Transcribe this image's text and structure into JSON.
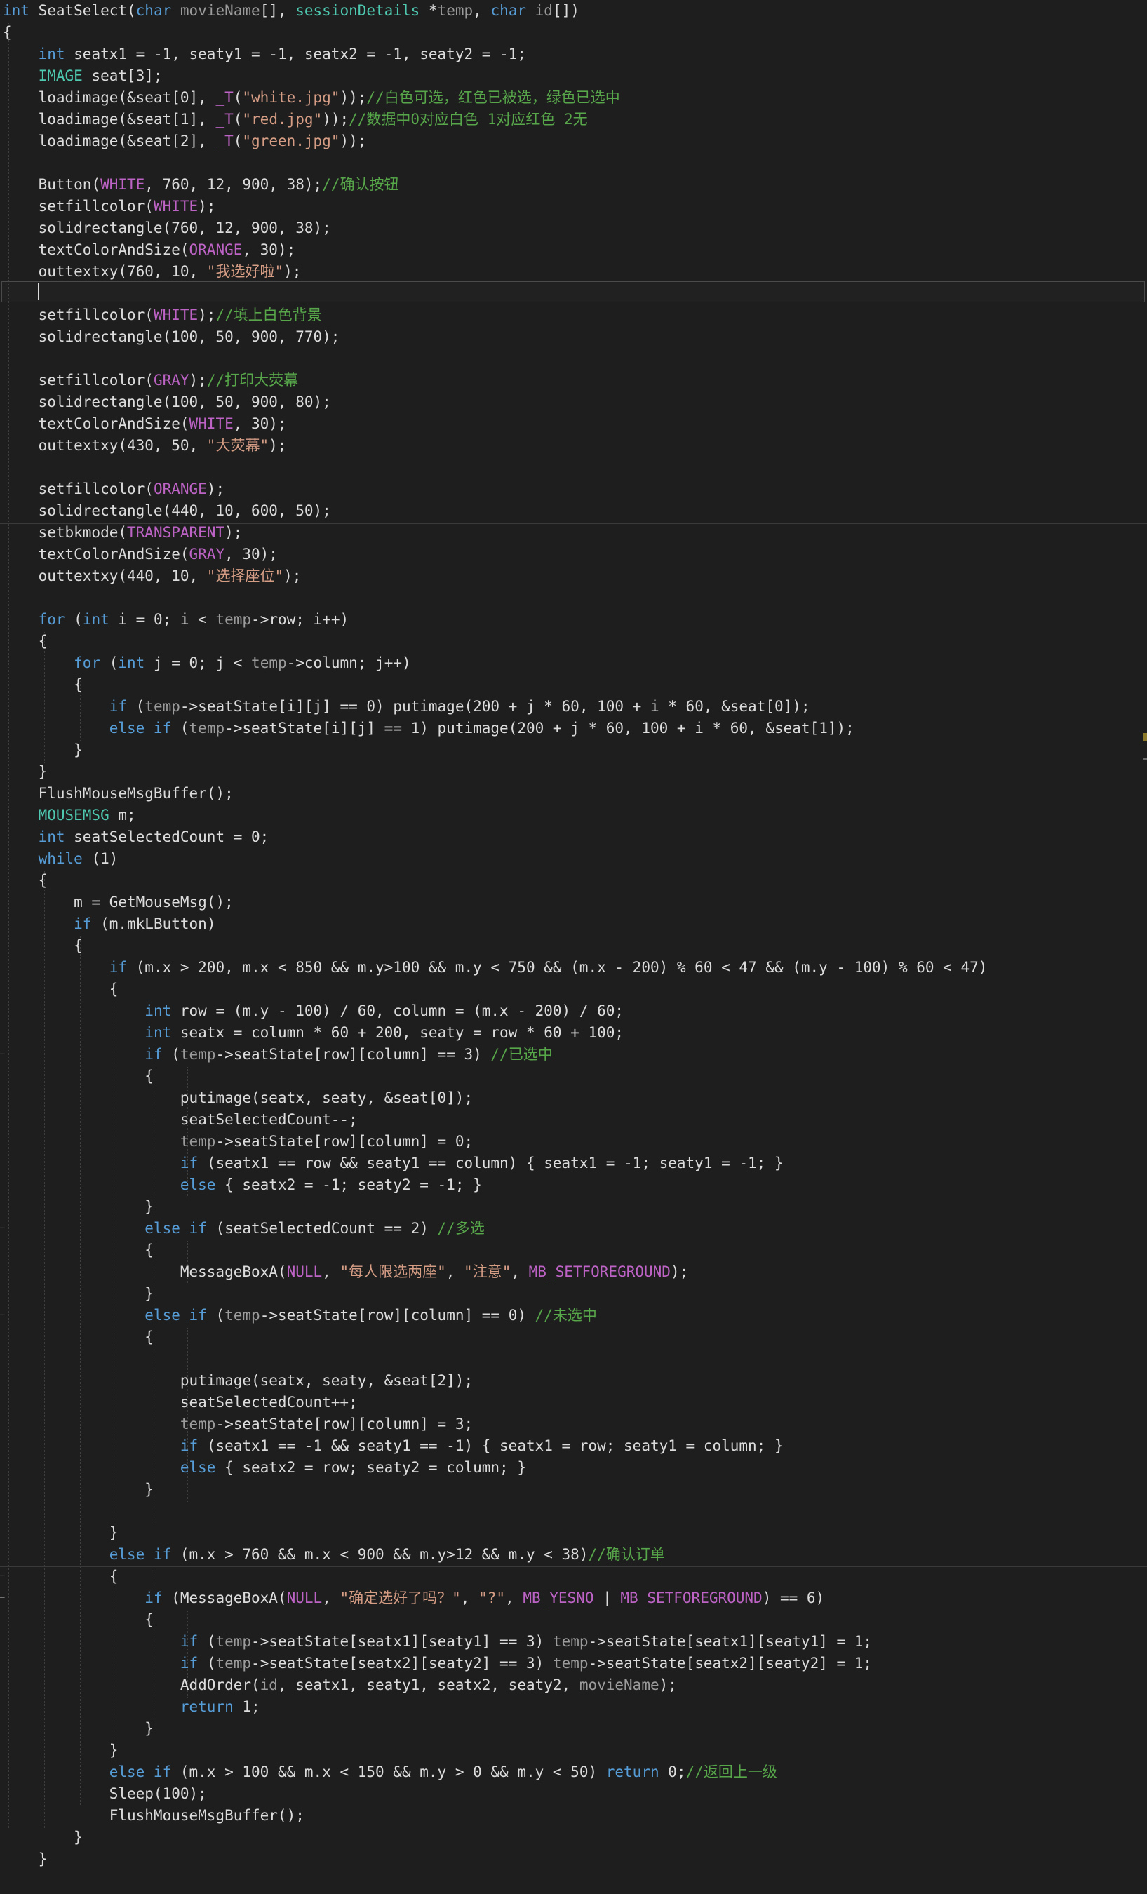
{
  "colors": {
    "background": "#1e1e1e",
    "keyword": "#569cd6",
    "type": "#4ec9b0",
    "string": "#d69d85",
    "comment": "#57a64a",
    "macro": "#bd63c5",
    "param": "#9b9b9b",
    "plain": "#dcdcdc"
  },
  "code": {
    "lines": [
      [
        [
          "kw",
          "int"
        ],
        [
          "pl",
          " SeatSelect("
        ],
        [
          "kw",
          "char"
        ],
        [
          "var",
          " movieName"
        ],
        [
          "pl",
          "[], "
        ],
        [
          "ty",
          "sessionDetails"
        ],
        [
          "pl",
          " *"
        ],
        [
          "var",
          "temp"
        ],
        [
          "pl",
          ", "
        ],
        [
          "kw",
          "char"
        ],
        [
          "var",
          " id"
        ],
        [
          "pl",
          "[])"
        ]
      ],
      [
        [
          "pl",
          "{"
        ]
      ],
      [
        [
          "pl",
          "    "
        ],
        [
          "kw",
          "int"
        ],
        [
          "pl",
          " seatx1 = -1, seaty1 = -1, seatx2 = -1, seaty2 = -1;"
        ]
      ],
      [
        [
          "pl",
          "    "
        ],
        [
          "ty",
          "IMAGE"
        ],
        [
          "pl",
          " seat[3];"
        ]
      ],
      [
        [
          "pl",
          "    loadimage(&seat[0], "
        ],
        [
          "mac",
          "_T"
        ],
        [
          "pl",
          "("
        ],
        [
          "str",
          "\"white.jpg\""
        ],
        [
          "pl",
          "));"
        ],
        [
          "cm",
          "//白色可选，红色已被选，绿色已选中"
        ]
      ],
      [
        [
          "pl",
          "    loadimage(&seat[1], "
        ],
        [
          "mac",
          "_T"
        ],
        [
          "pl",
          "("
        ],
        [
          "str",
          "\"red.jpg\""
        ],
        [
          "pl",
          "));"
        ],
        [
          "cm",
          "//数据中0对应白色 1对应红色 2无"
        ]
      ],
      [
        [
          "pl",
          "    loadimage(&seat[2], "
        ],
        [
          "mac",
          "_T"
        ],
        [
          "pl",
          "("
        ],
        [
          "str",
          "\"green.jpg\""
        ],
        [
          "pl",
          "));"
        ]
      ],
      [
        [
          "pl",
          ""
        ]
      ],
      [
        [
          "pl",
          "    Button("
        ],
        [
          "mac",
          "WHITE"
        ],
        [
          "pl",
          ", 760, 12, 900, 38);"
        ],
        [
          "cm",
          "//确认按钮"
        ]
      ],
      [
        [
          "pl",
          "    setfillcolor("
        ],
        [
          "mac",
          "WHITE"
        ],
        [
          "pl",
          ");"
        ]
      ],
      [
        [
          "pl",
          "    solidrectangle(760, 12, 900, 38);"
        ]
      ],
      [
        [
          "pl",
          "    textColorAndSize("
        ],
        [
          "mac",
          "ORANGE"
        ],
        [
          "pl",
          ", 30);"
        ]
      ],
      [
        [
          "pl",
          "    outtextxy(760, 10, "
        ],
        [
          "str",
          "\"我选好啦\""
        ],
        [
          "pl",
          ");"
        ]
      ],
      [
        [
          "pl",
          ""
        ]
      ],
      [
        [
          "pl",
          "    setfillcolor("
        ],
        [
          "mac",
          "WHITE"
        ],
        [
          "pl",
          ");"
        ],
        [
          "cm",
          "//填上白色背景"
        ]
      ],
      [
        [
          "pl",
          "    solidrectangle(100, 50, 900, 770);"
        ]
      ],
      [
        [
          "pl",
          ""
        ]
      ],
      [
        [
          "pl",
          "    setfillcolor("
        ],
        [
          "mac",
          "GRAY"
        ],
        [
          "pl",
          ");"
        ],
        [
          "cm",
          "//打印大荧幕"
        ]
      ],
      [
        [
          "pl",
          "    solidrectangle(100, 50, 900, 80);"
        ]
      ],
      [
        [
          "pl",
          "    textColorAndSize("
        ],
        [
          "mac",
          "WHITE"
        ],
        [
          "pl",
          ", 30);"
        ]
      ],
      [
        [
          "pl",
          "    outtextxy(430, 50, "
        ],
        [
          "str",
          "\"大荧幕\""
        ],
        [
          "pl",
          ");"
        ]
      ],
      [
        [
          "pl",
          ""
        ]
      ],
      [
        [
          "pl",
          "    setfillcolor("
        ],
        [
          "mac",
          "ORANGE"
        ],
        [
          "pl",
          ");"
        ]
      ],
      [
        [
          "pl",
          "    solidrectangle(440, 10, 600, 50);"
        ]
      ],
      [
        [
          "pl",
          "    setbkmode("
        ],
        [
          "mac",
          "TRANSPARENT"
        ],
        [
          "pl",
          ");"
        ]
      ],
      [
        [
          "pl",
          "    textColorAndSize("
        ],
        [
          "mac",
          "GRAY"
        ],
        [
          "pl",
          ", 30);"
        ]
      ],
      [
        [
          "pl",
          "    outtextxy(440, 10, "
        ],
        [
          "str",
          "\"选择座位\""
        ],
        [
          "pl",
          ");"
        ]
      ],
      [
        [
          "pl",
          ""
        ]
      ],
      [
        [
          "pl",
          "    "
        ],
        [
          "kw",
          "for"
        ],
        [
          "pl",
          " ("
        ],
        [
          "kw",
          "int"
        ],
        [
          "pl",
          " i = 0; i < "
        ],
        [
          "var",
          "temp"
        ],
        [
          "pl",
          "->row; i++)"
        ]
      ],
      [
        [
          "pl",
          "    {"
        ]
      ],
      [
        [
          "pl",
          "        "
        ],
        [
          "kw",
          "for"
        ],
        [
          "pl",
          " ("
        ],
        [
          "kw",
          "int"
        ],
        [
          "pl",
          " j = 0; j < "
        ],
        [
          "var",
          "temp"
        ],
        [
          "pl",
          "->column; j++)"
        ]
      ],
      [
        [
          "pl",
          "        {"
        ]
      ],
      [
        [
          "pl",
          "            "
        ],
        [
          "kw",
          "if"
        ],
        [
          "pl",
          " ("
        ],
        [
          "var",
          "temp"
        ],
        [
          "pl",
          "->seatState[i][j] == 0) putimage(200 + j * 60, 100 + i * 60, &seat[0]);"
        ]
      ],
      [
        [
          "pl",
          "            "
        ],
        [
          "kw",
          "else if"
        ],
        [
          "pl",
          " ("
        ],
        [
          "var",
          "temp"
        ],
        [
          "pl",
          "->seatState[i][j] == 1) putimage(200 + j * 60, 100 + i * 60, &seat[1]);"
        ]
      ],
      [
        [
          "pl",
          "        }"
        ]
      ],
      [
        [
          "pl",
          "    }"
        ]
      ],
      [
        [
          "pl",
          "    FlushMouseMsgBuffer();"
        ]
      ],
      [
        [
          "pl",
          "    "
        ],
        [
          "ty",
          "MOUSEMSG"
        ],
        [
          "pl",
          " m;"
        ]
      ],
      [
        [
          "pl",
          "    "
        ],
        [
          "kw",
          "int"
        ],
        [
          "pl",
          " seatSelectedCount = 0;"
        ]
      ],
      [
        [
          "pl",
          "    "
        ],
        [
          "kw",
          "while"
        ],
        [
          "pl",
          " (1)"
        ]
      ],
      [
        [
          "pl",
          "    {"
        ]
      ],
      [
        [
          "pl",
          "        m = GetMouseMsg();"
        ]
      ],
      [
        [
          "pl",
          "        "
        ],
        [
          "kw",
          "if"
        ],
        [
          "pl",
          " (m.mkLButton)"
        ]
      ],
      [
        [
          "pl",
          "        {"
        ]
      ],
      [
        [
          "pl",
          "            "
        ],
        [
          "kw",
          "if"
        ],
        [
          "pl",
          " (m.x > 200, m.x < 850 && m.y>100 && m.y < 750 && (m.x - 200) % 60 < 47 && (m.y - 100) % 60 < 47)"
        ]
      ],
      [
        [
          "pl",
          "            {"
        ]
      ],
      [
        [
          "pl",
          "                "
        ],
        [
          "kw",
          "int"
        ],
        [
          "pl",
          " row = (m.y - 100) / 60, column = (m.x - 200) / 60;"
        ]
      ],
      [
        [
          "pl",
          "                "
        ],
        [
          "kw",
          "int"
        ],
        [
          "pl",
          " seatx = column * 60 + 200, seaty = row * 60 + 100;"
        ]
      ],
      [
        [
          "pl",
          "                "
        ],
        [
          "kw",
          "if"
        ],
        [
          "pl",
          " ("
        ],
        [
          "var",
          "temp"
        ],
        [
          "pl",
          "->seatState[row][column] == 3) "
        ],
        [
          "cm",
          "//已选中"
        ]
      ],
      [
        [
          "pl",
          "                {"
        ]
      ],
      [
        [
          "pl",
          "                    putimage(seatx, seaty, &seat[0]);"
        ]
      ],
      [
        [
          "pl",
          "                    seatSelectedCount--;"
        ]
      ],
      [
        [
          "pl",
          "                    "
        ],
        [
          "var",
          "temp"
        ],
        [
          "pl",
          "->seatState[row][column] = 0;"
        ]
      ],
      [
        [
          "pl",
          "                    "
        ],
        [
          "kw",
          "if"
        ],
        [
          "pl",
          " (seatx1 == row && seaty1 == column) { seatx1 = -1; seaty1 = -1; }"
        ]
      ],
      [
        [
          "pl",
          "                    "
        ],
        [
          "kw",
          "else"
        ],
        [
          "pl",
          " { seatx2 = -1; seaty2 = -1; }"
        ]
      ],
      [
        [
          "pl",
          "                }"
        ]
      ],
      [
        [
          "pl",
          "                "
        ],
        [
          "kw",
          "else if"
        ],
        [
          "pl",
          " (seatSelectedCount == 2) "
        ],
        [
          "cm",
          "//多选"
        ]
      ],
      [
        [
          "pl",
          "                {"
        ]
      ],
      [
        [
          "pl",
          "                    MessageBoxA("
        ],
        [
          "mac",
          "NULL"
        ],
        [
          "pl",
          ", "
        ],
        [
          "str",
          "\"每人限选两座\""
        ],
        [
          "pl",
          ", "
        ],
        [
          "str",
          "\"注意\""
        ],
        [
          "pl",
          ", "
        ],
        [
          "mac",
          "MB_SETFOREGROUND"
        ],
        [
          "pl",
          ");"
        ]
      ],
      [
        [
          "pl",
          "                }"
        ]
      ],
      [
        [
          "pl",
          "                "
        ],
        [
          "kw",
          "else if"
        ],
        [
          "pl",
          " ("
        ],
        [
          "var",
          "temp"
        ],
        [
          "pl",
          "->seatState[row][column] == 0) "
        ],
        [
          "cm",
          "//未选中"
        ]
      ],
      [
        [
          "pl",
          "                {"
        ]
      ],
      [
        [
          "pl",
          ""
        ]
      ],
      [
        [
          "pl",
          "                    putimage(seatx, seaty, &seat[2]);"
        ]
      ],
      [
        [
          "pl",
          "                    seatSelectedCount++;"
        ]
      ],
      [
        [
          "pl",
          "                    "
        ],
        [
          "var",
          "temp"
        ],
        [
          "pl",
          "->seatState[row][column] = 3;"
        ]
      ],
      [
        [
          "pl",
          "                    "
        ],
        [
          "kw",
          "if"
        ],
        [
          "pl",
          " (seatx1 == -1 && seaty1 == -1) { seatx1 = row; seaty1 = column; }"
        ]
      ],
      [
        [
          "pl",
          "                    "
        ],
        [
          "kw",
          "else"
        ],
        [
          "pl",
          " { seatx2 = row; seaty2 = column; }"
        ]
      ],
      [
        [
          "pl",
          "                }"
        ]
      ],
      [
        [
          "pl",
          ""
        ]
      ],
      [
        [
          "pl",
          "            }"
        ]
      ],
      [
        [
          "pl",
          "            "
        ],
        [
          "kw",
          "else if"
        ],
        [
          "pl",
          " (m.x > 760 && m.x < 900 && m.y>12 && m.y < 38)"
        ],
        [
          "cm",
          "//确认订单"
        ]
      ],
      [
        [
          "pl",
          "            {"
        ]
      ],
      [
        [
          "pl",
          "                "
        ],
        [
          "kw",
          "if"
        ],
        [
          "pl",
          " (MessageBoxA("
        ],
        [
          "mac",
          "NULL"
        ],
        [
          "pl",
          ", "
        ],
        [
          "str",
          "\"确定选好了吗？\""
        ],
        [
          "pl",
          ", "
        ],
        [
          "str",
          "\"?\""
        ],
        [
          "pl",
          ", "
        ],
        [
          "mac",
          "MB_YESNO"
        ],
        [
          "pl",
          " | "
        ],
        [
          "mac",
          "MB_SETFOREGROUND"
        ],
        [
          "pl",
          ") == 6)"
        ]
      ],
      [
        [
          "pl",
          "                {"
        ]
      ],
      [
        [
          "pl",
          "                    "
        ],
        [
          "kw",
          "if"
        ],
        [
          "pl",
          " ("
        ],
        [
          "var",
          "temp"
        ],
        [
          "pl",
          "->seatState[seatx1][seaty1] == 3) "
        ],
        [
          "var",
          "temp"
        ],
        [
          "pl",
          "->seatState[seatx1][seaty1] = 1;"
        ]
      ],
      [
        [
          "pl",
          "                    "
        ],
        [
          "kw",
          "if"
        ],
        [
          "pl",
          " ("
        ],
        [
          "var",
          "temp"
        ],
        [
          "pl",
          "->seatState[seatx2][seaty2] == 3) "
        ],
        [
          "var",
          "temp"
        ],
        [
          "pl",
          "->seatState[seatx2][seaty2] = 1;"
        ]
      ],
      [
        [
          "pl",
          "                    AddOrder("
        ],
        [
          "var",
          "id"
        ],
        [
          "pl",
          ", seatx1, seaty1, seatx2, seaty2, "
        ],
        [
          "var",
          "movieName"
        ],
        [
          "pl",
          ");"
        ]
      ],
      [
        [
          "pl",
          "                    "
        ],
        [
          "kw",
          "return"
        ],
        [
          "pl",
          " 1;"
        ]
      ],
      [
        [
          "pl",
          "                }"
        ]
      ],
      [
        [
          "pl",
          "            }"
        ]
      ],
      [
        [
          "pl",
          "            "
        ],
        [
          "kw",
          "else if"
        ],
        [
          "pl",
          " (m.x > 100 && m.x < 150 && m.y > 0 && m.y < 50) "
        ],
        [
          "kw",
          "return"
        ],
        [
          "pl",
          " 0;"
        ],
        [
          "cm",
          "//返回上一级"
        ]
      ],
      [
        [
          "pl",
          "            Sleep(100);"
        ]
      ],
      [
        [
          "pl",
          "            FlushMouseMsgBuffer();"
        ]
      ],
      [
        [
          "pl",
          "        }"
        ]
      ],
      [
        [
          "pl",
          "    }"
        ]
      ]
    ]
  }
}
